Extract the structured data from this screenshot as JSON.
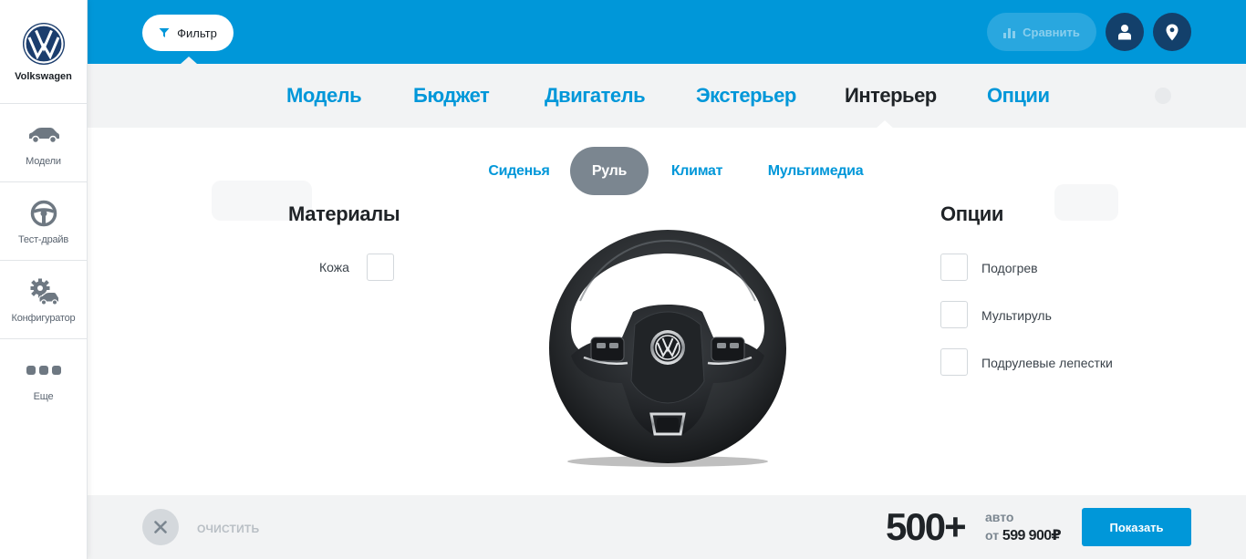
{
  "sidebar": {
    "brand": "Volkswagen",
    "items": [
      {
        "label": "Модели",
        "icon": "car-icon"
      },
      {
        "label": "Тест-драйв",
        "icon": "steering-wheel-icon"
      },
      {
        "label": "Конфигуратор",
        "icon": "gear-car-icon"
      },
      {
        "label": "Еще",
        "icon": "more-dots-icon"
      }
    ]
  },
  "topbar": {
    "filter_label": "Фильтр",
    "compare_label": "Сравнить",
    "profile_icon": "user-icon",
    "location_icon": "location-pin-icon"
  },
  "categories": [
    "Модель",
    "Бюджет",
    "Двигатель",
    "Экстерьер",
    "Интерьер",
    "Опции"
  ],
  "active_category": "Интерьер",
  "subtabs": [
    "Сиденья",
    "Руль",
    "Климат",
    "Мультимедиа"
  ],
  "active_subtab": "Руль",
  "materials": {
    "title": "Материалы",
    "items": [
      "Кожа"
    ]
  },
  "options": {
    "title": "Опции",
    "items": [
      "Подогрев",
      "Мультируль",
      "Подрулевые лепестки"
    ]
  },
  "bottombar": {
    "clear_label": "очистить",
    "count": "500+",
    "count_unit": "авто",
    "price_prefix": "от",
    "price": "599 900₽",
    "show_label": "Показать"
  },
  "colors": {
    "accent": "#0097d9",
    "navy": "#13406b",
    "active_tab": "#7b8690",
    "background": "#f2f3f4"
  }
}
